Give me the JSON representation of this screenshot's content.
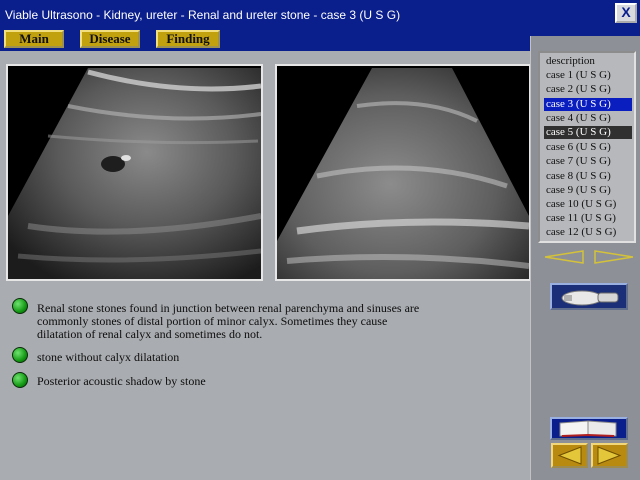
{
  "window": {
    "title": "Viable Ultrasono - Kidney, ureter - Renal and ureter stone - case 3 (U S G)",
    "close_label": "X"
  },
  "menu": [
    {
      "label": "Main"
    },
    {
      "label": "Disease"
    },
    {
      "label": "Finding"
    }
  ],
  "case_list": {
    "header": "description",
    "items": [
      "case 1 (U S G)",
      "case 2 (U S G)",
      "case 3 (U S G)",
      "case 4 (U S G)",
      "case 5 (U S G)",
      "case 6 (U S G)",
      "case 7 (U S G)",
      "case 8 (U S G)",
      "case 9 (U S G)",
      "case 10 (U S G)",
      "case 11 (U S G)",
      "case 12 (U S G)"
    ],
    "selected": "case 3 (U S G)",
    "hovered": "case 5 (U S G)"
  },
  "findings": [
    {
      "lines": [
        "Renal stone stones found in junction between renal parenchyma and sinuses are",
        "commonly stones of distal portion of minor calyx. Sometimes they cause",
        "dilatation of renal calyx and sometimes do not."
      ]
    },
    {
      "lines": [
        "stone without calyx dilatation"
      ]
    },
    {
      "lines": [
        "Posterior acoustic shadow by stone"
      ]
    }
  ],
  "colors": {
    "title_bar": "#0a1e8c",
    "menu_button": "#c2a10f",
    "selection": "#0a1ec0",
    "bullet": "#1a9a1a",
    "nav_arrow": "#d4c23a"
  },
  "icons": {
    "close": "close-icon",
    "list_prev": "triangle-left-icon",
    "list_next": "triangle-right-icon",
    "probe": "ultrasound-probe-icon",
    "book": "open-book-icon",
    "prev": "prev-arrow-icon",
    "next": "next-arrow-icon"
  }
}
